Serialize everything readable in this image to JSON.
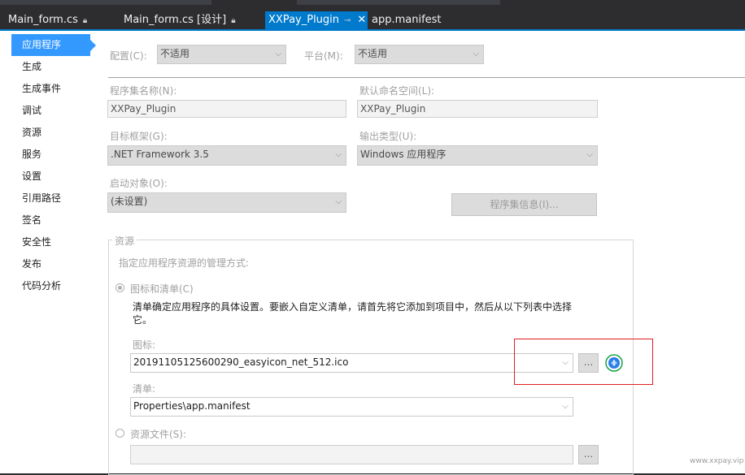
{
  "tabs": [
    {
      "label": "Main_form.cs",
      "pinned_icon": "lock-icon"
    },
    {
      "label": "Main_form.cs [设计]",
      "pinned_icon": "lock-icon"
    },
    {
      "label": "XXPay_Plugin",
      "pin": "⊸",
      "close": "✕",
      "active": true
    },
    {
      "label": "app.manifest"
    }
  ],
  "sidebar": {
    "items": [
      "应用程序",
      "生成",
      "生成事件",
      "调试",
      "资源",
      "服务",
      "设置",
      "引用路径",
      "签名",
      "安全性",
      "发布",
      "代码分析"
    ],
    "selected_index": 0
  },
  "config": {
    "config_label": "配置(C):",
    "config_value": "不适用",
    "platform_label": "平台(M):",
    "platform_value": "不适用"
  },
  "assembly": {
    "name_label": "程序集名称(N):",
    "name_value": "XXPay_Plugin",
    "namespace_label": "默认命名空间(L):",
    "namespace_value": "XXPay_Plugin",
    "framework_label": "目标框架(G):",
    "framework_value": ".NET Framework 3.5",
    "output_label": "输出类型(U):",
    "output_value": "Windows 应用程序",
    "startup_label": "启动对象(O):",
    "startup_value": "(未设置)",
    "info_button": "程序集信息(I)..."
  },
  "resources": {
    "group_title": "资源",
    "hint": "指定应用程序资源的管理方式:",
    "icon_manifest_label": "图标和清单(C)",
    "description_line1": "清单确定应用程序的具体设置。要嵌入自定义清单，请首先将它添加到项目中，然后从以下列表中选择",
    "description_line2": "它。",
    "icon_label": "图标:",
    "icon_value": "20191105125600290_easyicon_net_512.ico",
    "browse_label": "...",
    "manifest_label": "清单:",
    "manifest_value": "Properties\\app.manifest",
    "resource_file_label": "资源文件(S):",
    "resource_file_value": ""
  },
  "watermark": "www.xxpay.vip",
  "colors": {
    "accent": "#007acc",
    "selected": "#3399ff",
    "highlight_box": "#e01e1e"
  }
}
